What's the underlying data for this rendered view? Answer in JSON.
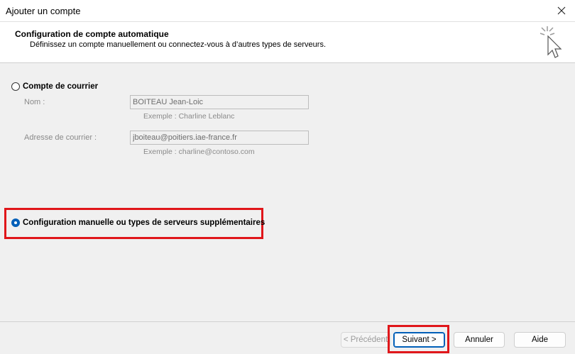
{
  "window": {
    "title": "Ajouter un compte"
  },
  "header": {
    "title": "Configuration de compte automatique",
    "subtitle": "Définissez un compte manuellement ou connectez-vous à d’autres types de serveurs."
  },
  "options": {
    "email_account_label": "Compte de courrier",
    "manual_config_label": "Configuration manuelle ou types de serveurs supplémentaires",
    "selected": "manual"
  },
  "fields": {
    "name_label": "Nom :",
    "name_value": "BOITEAU Jean-Loic",
    "name_example": "Exemple : Charline Leblanc",
    "email_label": "Adresse de courrier :",
    "email_value": "jboiteau@poitiers.iae-france.fr",
    "email_example": "Exemple : charline@contoso.com"
  },
  "buttons": {
    "back": "< Précédent",
    "next": "Suivant >",
    "cancel": "Annuler",
    "help": "Aide"
  },
  "colors": {
    "accent": "#005fb8",
    "highlight": "#e0161a"
  }
}
